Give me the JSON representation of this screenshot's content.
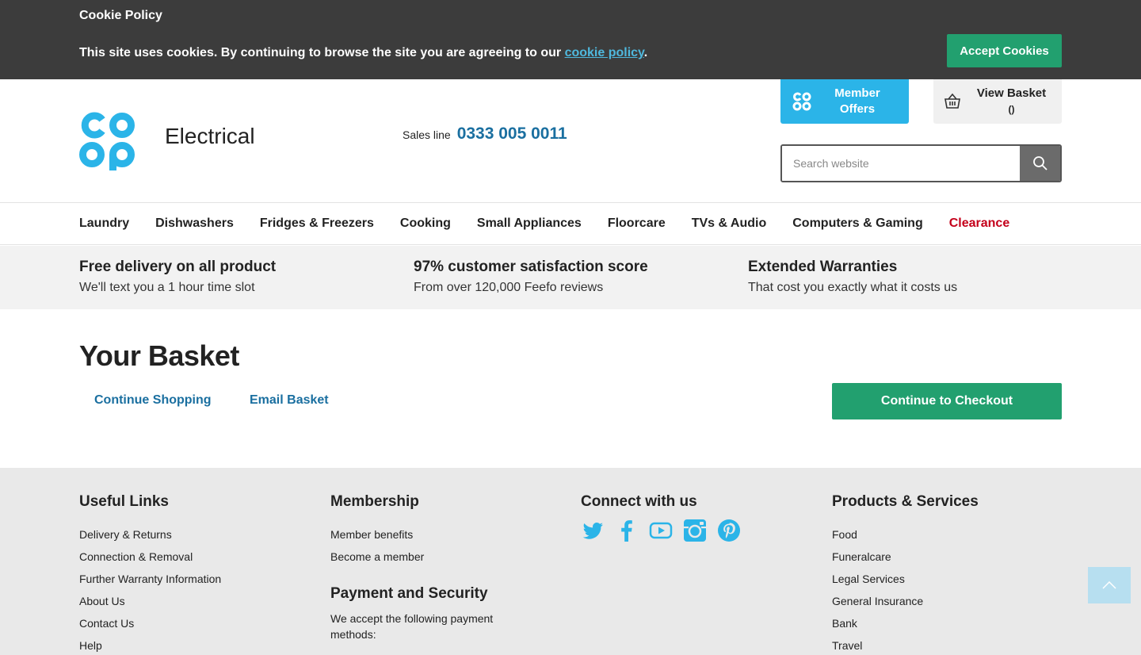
{
  "cookie": {
    "title": "Cookie Policy",
    "text_before": "This site uses cookies. By continuing to browse the site you are agreeing to our ",
    "link": "cookie policy",
    "text_after": ".",
    "accept_label": "Accept Cookies"
  },
  "header": {
    "brand": "Electrical",
    "sales_label": "Sales line",
    "sales_number": "0333 005 0011",
    "member_label_1": "Member",
    "member_label_2": "Offers",
    "basket_label": "View Basket",
    "basket_count": "()",
    "search_placeholder": "Search website"
  },
  "nav": {
    "items": [
      "Laundry",
      "Dishwashers",
      "Fridges & Freezers",
      "Cooking",
      "Small Appliances",
      "Floorcare",
      "TVs & Audio",
      "Computers & Gaming",
      "Clearance"
    ]
  },
  "usp": [
    {
      "title": "Free delivery on all product",
      "sub": "We'll text you a 1 hour time slot"
    },
    {
      "title": "97% customer satisfaction score",
      "sub": "From over 120,000 Feefo reviews"
    },
    {
      "title": "Extended Warranties",
      "sub": "That cost you exactly what it costs us"
    }
  ],
  "basket": {
    "title": "Your Basket",
    "continue_shopping": "Continue Shopping",
    "email_basket": "Email Basket",
    "checkout": "Continue to Checkout"
  },
  "footer": {
    "useful_links": {
      "heading": "Useful Links",
      "items": [
        "Delivery & Returns",
        "Connection & Removal",
        "Further Warranty Information",
        "About Us",
        "Contact Us",
        "Help"
      ]
    },
    "membership": {
      "heading": "Membership",
      "items": [
        "Member benefits",
        "Become a member"
      ]
    },
    "payment": {
      "heading": "Payment and Security",
      "text": "We accept the following payment methods:"
    },
    "connect": {
      "heading": "Connect with us",
      "icons": [
        "twitter-icon",
        "facebook-icon",
        "youtube-icon",
        "instagram-icon",
        "pinterest-icon"
      ]
    },
    "products": {
      "heading": "Products & Services",
      "items": [
        "Food",
        "Funeralcare",
        "Legal Services",
        "General Insurance",
        "Bank",
        "Travel"
      ]
    }
  },
  "colors": {
    "brand_blue": "#2bb4e8",
    "link_blue": "#1a6fa0",
    "green": "#22a06f",
    "clearance_red": "#c4001a",
    "cookie_bg": "#3c3c3c"
  }
}
